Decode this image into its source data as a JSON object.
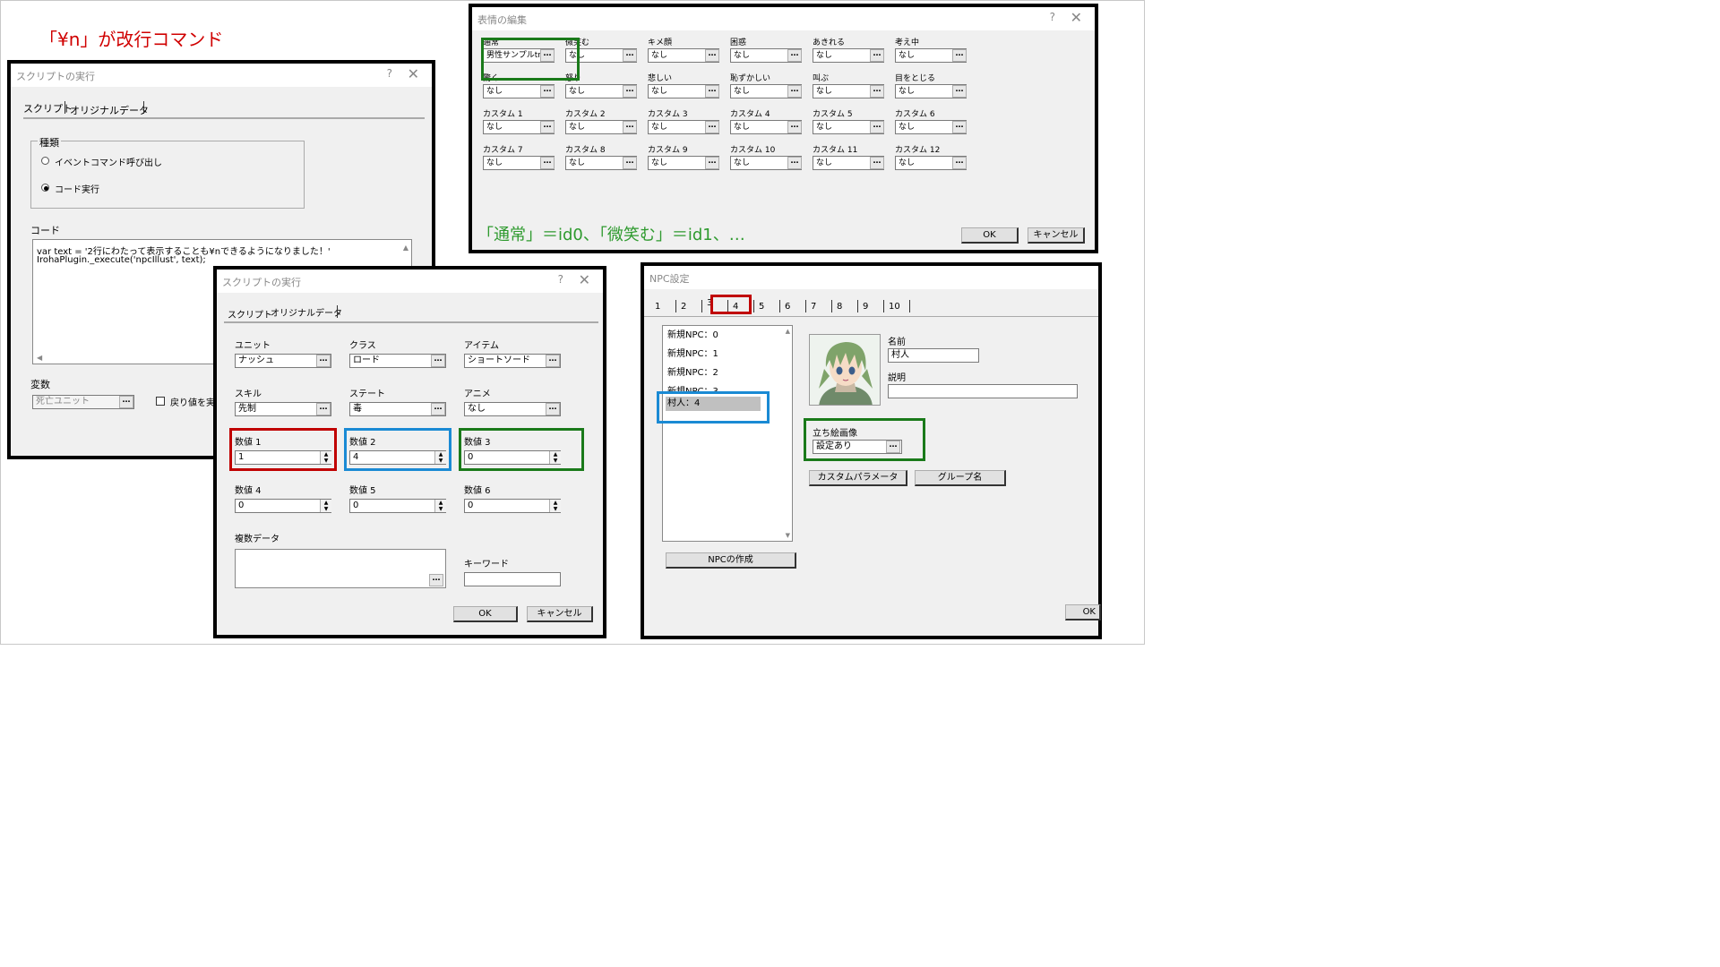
{
  "annotation_top": "「¥n」が改行コマンド",
  "annotation_expression": "「通常」＝id0、「微笑む」＝id1、…",
  "script_dialog": {
    "title": "スクリプトの実行",
    "help": "?",
    "close": "✕",
    "tabs": [
      "スクリプト",
      "オリジナルデータ"
    ],
    "group_label": "種類",
    "radio1": "イベントコマンド呼び出し",
    "radio2": "コード実行",
    "code_label": "コード",
    "code_line1": "var text = '2行にわたって表示することも¥nできるようになりました！'",
    "code_line2": "IrohaPlugin._execute('npcIllust', text);",
    "var_label": "変数",
    "var_value": "死亡ユニット",
    "return_label": "戻り値を実"
  },
  "orig_dialog": {
    "title": "スクリプトの実行",
    "help": "?",
    "close": "✕",
    "tabs": [
      "スクリプト",
      "オリジナルデータ"
    ],
    "unit_label": "ユニット",
    "unit_value": "ナッシュ",
    "class_label": "クラス",
    "class_value": "ロード",
    "item_label": "アイテム",
    "item_value": "ショートソード",
    "skill_label": "スキル",
    "skill_value": "先制",
    "state_label": "ステート",
    "state_value": "毒",
    "anime_label": "アニメ",
    "anime_value": "なし",
    "num1_label": "数値 1",
    "num1_value": "1",
    "num2_label": "数値 2",
    "num2_value": "4",
    "num3_label": "数値 3",
    "num3_value": "0",
    "num4_label": "数値 4",
    "num4_value": "0",
    "num5_label": "数値 5",
    "num5_value": "0",
    "num6_label": "数値 6",
    "num6_value": "0",
    "multi_label": "複数データ",
    "keyword_label": "キーワード",
    "ok": "OK",
    "cancel": "キャンセル"
  },
  "expr_dialog": {
    "title": "表情の編集",
    "help": "?",
    "close": "✕",
    "cells": [
      {
        "label": "通常",
        "value": "男性サンプルtrim"
      },
      {
        "label": "微笑む",
        "value": "なし"
      },
      {
        "label": "キメ顔",
        "value": "なし"
      },
      {
        "label": "困惑",
        "value": "なし"
      },
      {
        "label": "あきれる",
        "value": "なし"
      },
      {
        "label": "考え中",
        "value": "なし"
      },
      {
        "label": "驚く",
        "value": "なし"
      },
      {
        "label": "怒り",
        "value": "なし"
      },
      {
        "label": "悲しい",
        "value": "なし"
      },
      {
        "label": "恥ずかしい",
        "value": "なし"
      },
      {
        "label": "叫ぶ",
        "value": "なし"
      },
      {
        "label": "目をとじる",
        "value": "なし"
      },
      {
        "label": "カスタム 1",
        "value": "なし"
      },
      {
        "label": "カスタム 2",
        "value": "なし"
      },
      {
        "label": "カスタム 3",
        "value": "なし"
      },
      {
        "label": "カスタム 4",
        "value": "なし"
      },
      {
        "label": "カスタム 5",
        "value": "なし"
      },
      {
        "label": "カスタム 6",
        "value": "なし"
      },
      {
        "label": "カスタム 7",
        "value": "なし"
      },
      {
        "label": "カスタム 8",
        "value": "なし"
      },
      {
        "label": "カスタム 9",
        "value": "なし"
      },
      {
        "label": "カスタム 10",
        "value": "なし"
      },
      {
        "label": "カスタム 11",
        "value": "なし"
      },
      {
        "label": "カスタム 12",
        "value": "なし"
      }
    ],
    "ok": "OK",
    "cancel": "キャンセル"
  },
  "npc_dialog": {
    "title": "NPC設定",
    "tabs": [
      "1",
      "2",
      "3",
      "4",
      "5",
      "6",
      "7",
      "8",
      "9",
      "10"
    ],
    "list": [
      "新規NPC：0",
      "新規NPC：1",
      "新規NPC：2",
      "新規NPC：3",
      "村人：4"
    ],
    "name_label": "名前",
    "name_value": "村人",
    "desc_label": "説明",
    "stand_label": "立ち絵画像",
    "stand_value": "設定あり",
    "custom_param": "カスタムパラメータ",
    "group_name": "グループ名",
    "create_npc": "NPCの作成",
    "ok": "OK"
  },
  "ellipsis": "…",
  "colors": {
    "red": "#c00000",
    "blue": "#1a8ad4",
    "green": "#1a7a1a",
    "annotation_red": "#d00000",
    "annotation_green": "#2e9a2e"
  }
}
